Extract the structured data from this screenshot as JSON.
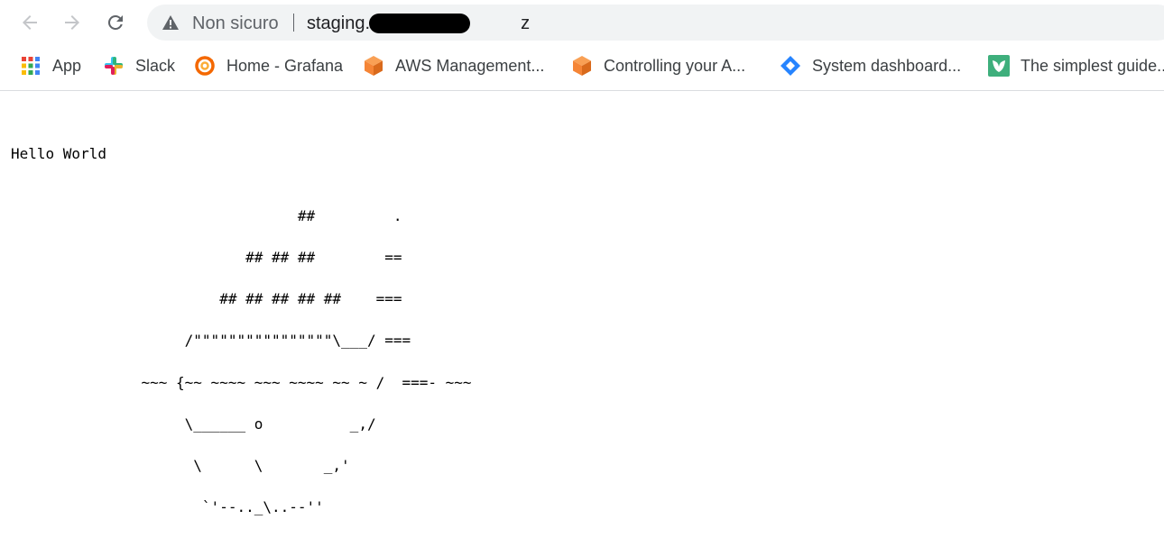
{
  "address_bar": {
    "security_label": "Non sicuro",
    "url": "staging.",
    "url_tail": "z"
  },
  "bookmarks": [
    {
      "label": "App",
      "icon": "apps-grid-icon"
    },
    {
      "label": "Slack",
      "icon": "slack-icon"
    },
    {
      "label": "Home - Grafana",
      "icon": "grafana-icon"
    },
    {
      "label": "AWS Management...",
      "icon": "aws-cube-icon"
    },
    {
      "label": "Controlling your A...",
      "icon": "aws-cube-icon"
    },
    {
      "label": "System dashboard...",
      "icon": "jira-icon"
    },
    {
      "label": "The simplest guide..",
      "icon": "leaf-icon"
    }
  ],
  "page": {
    "ascii_text": "Hello World\n\n\n                                 ##         .\n\n                           ## ## ##        ==\n\n                        ## ## ## ## ##    ===\n\n                    /\"\"\"\"\"\"\"\"\"\"\"\"\"\"\"\"\\___/ ===\n\n               ~~~ {~~ ~~~~ ~~~ ~~~~ ~~ ~ /  ===- ~~~\n\n                    \\______ o          _,/\n\n                     \\      \\       _,'\n\n                      `'--.._\\..--''"
  },
  "colors": {
    "icon_gray": "#5f6368",
    "omnibox_bg": "#f1f3f4",
    "aws_orange": "#f58536",
    "jira_blue": "#2684ff",
    "guide_green": "#3eaf7c",
    "grafana_orange": "#f46800"
  }
}
